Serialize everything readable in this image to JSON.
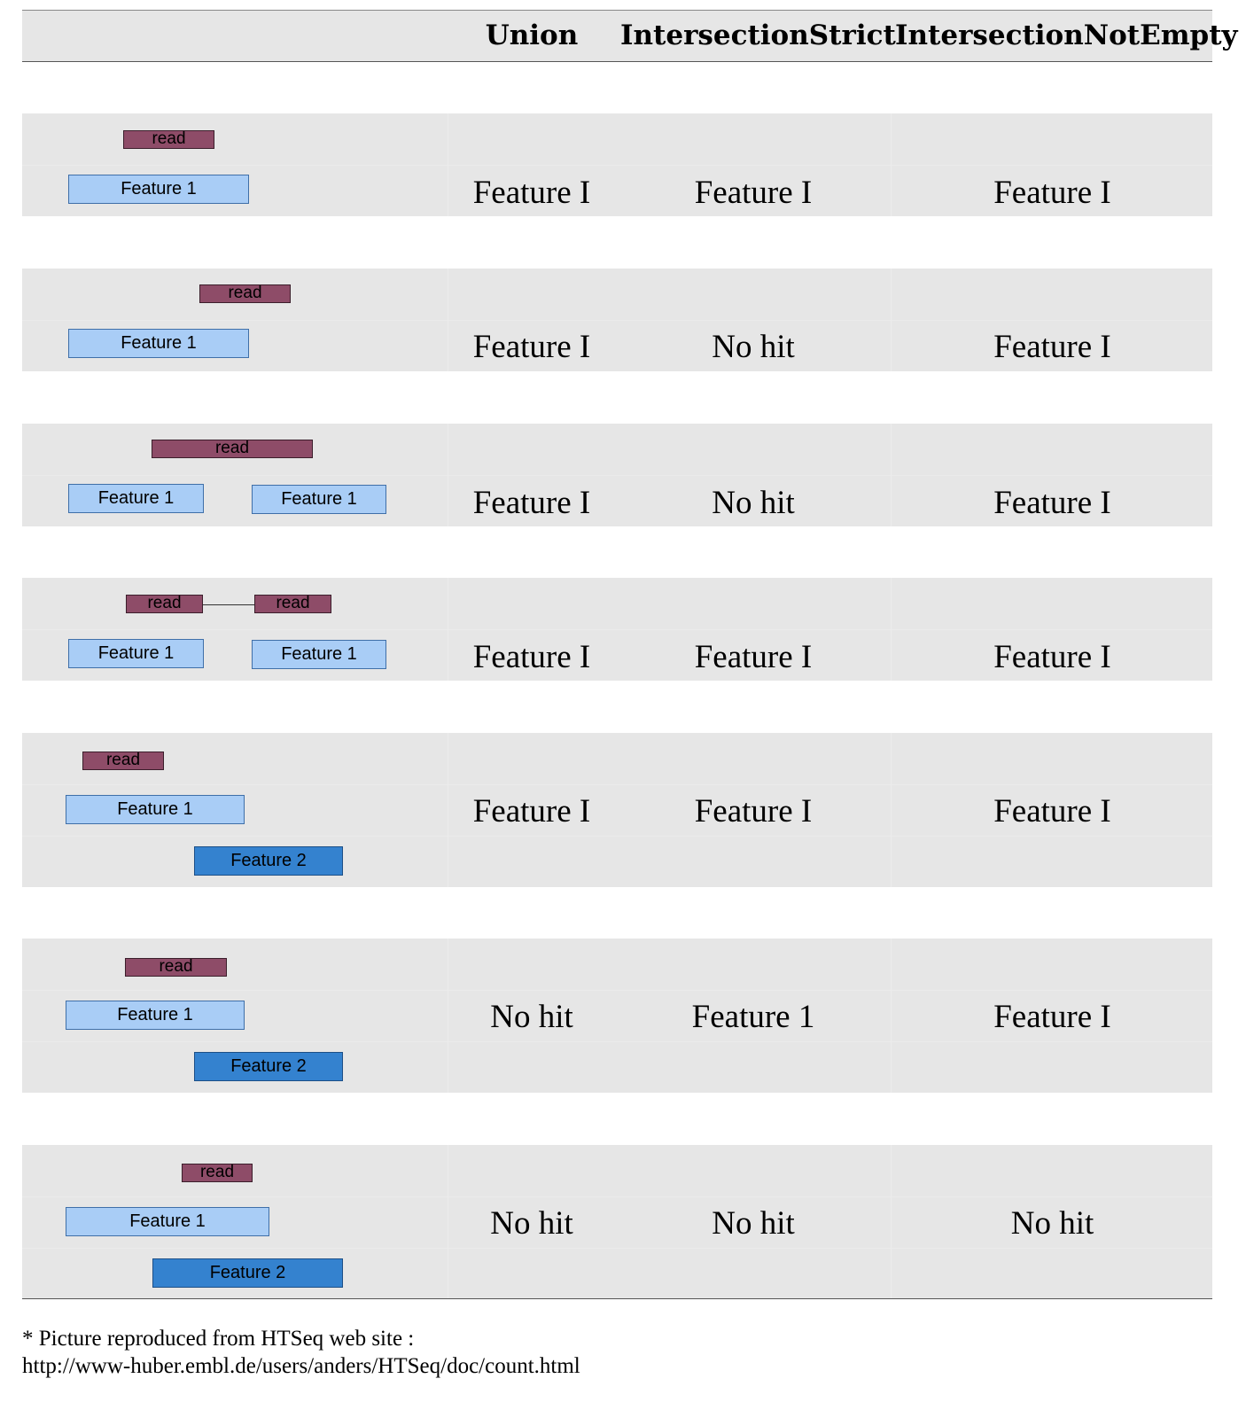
{
  "header": {
    "col1": "Union",
    "col2": "IntersectionStrict",
    "col3": "IntersectionNotEmpty"
  },
  "rows": [
    {
      "reads": [
        "read"
      ],
      "features": [
        "Feature 1"
      ],
      "union": "Feature I",
      "strict": "Feature I",
      "nonempty": "Feature I"
    },
    {
      "reads": [
        "read"
      ],
      "features": [
        "Feature 1"
      ],
      "union": "Feature I",
      "strict": "No hit",
      "nonempty": "Feature I"
    },
    {
      "reads": [
        "read"
      ],
      "features": [
        "Feature 1",
        "Feature 1"
      ],
      "union": "Feature I",
      "strict": "No hit",
      "nonempty": "Feature I"
    },
    {
      "reads": [
        "read",
        "read"
      ],
      "features": [
        "Feature 1",
        "Feature 1"
      ],
      "union": "Feature I",
      "strict": "Feature I",
      "nonempty": "Feature I"
    },
    {
      "reads": [
        "read"
      ],
      "features": [
        "Feature 1",
        "Feature 2"
      ],
      "union": "Feature I",
      "strict": "Feature I",
      "nonempty": "Feature I"
    },
    {
      "reads": [
        "read"
      ],
      "features": [
        "Feature 1",
        "Feature 2"
      ],
      "union": "No hit",
      "strict": "Feature 1",
      "nonempty": "Feature I"
    },
    {
      "reads": [
        "read"
      ],
      "features": [
        "Feature 1",
        "Feature 2"
      ],
      "union": "No hit",
      "strict": "No hit",
      "nonempty": "No hit"
    }
  ],
  "footnote": {
    "line1": "* Picture reproduced from HTSeq web site :",
    "line2": "http://www-huber.embl.de/users/anders/HTSeq/doc/count.html"
  },
  "colors": {
    "read": "#8e4c68",
    "feature1": "#a9cdf6",
    "feature2": "#3482cf",
    "band": "#e6e6e6"
  }
}
